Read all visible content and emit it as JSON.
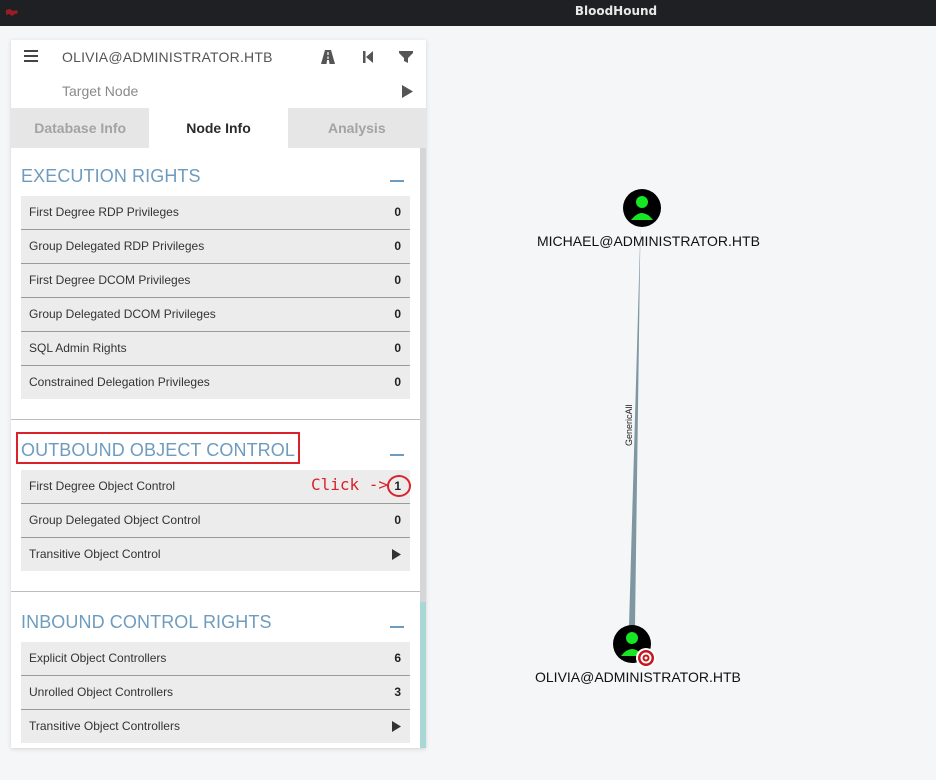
{
  "window": {
    "title": "BloodHound"
  },
  "search": {
    "source_node": "OLIVIA@ADMINISTRATOR.HTB",
    "target_placeholder": "Target Node"
  },
  "tabs": [
    {
      "label": "Database Info",
      "active": false
    },
    {
      "label": "Node Info",
      "active": true
    },
    {
      "label": "Analysis",
      "active": false
    }
  ],
  "sections": {
    "execution": {
      "title": "EXECUTION RIGHTS",
      "rows": [
        {
          "label": "First Degree RDP Privileges",
          "value": "0"
        },
        {
          "label": "Group Delegated RDP Privileges",
          "value": "0"
        },
        {
          "label": "First Degree DCOM Privileges",
          "value": "0"
        },
        {
          "label": "Group Delegated DCOM Privileges",
          "value": "0"
        },
        {
          "label": "SQL Admin Rights",
          "value": "0"
        },
        {
          "label": "Constrained Delegation Privileges",
          "value": "0"
        }
      ]
    },
    "outbound": {
      "title": "OUTBOUND OBJECT CONTROL",
      "rows": [
        {
          "label": "First Degree Object Control",
          "value": "1"
        },
        {
          "label": "Group Delegated Object Control",
          "value": "0"
        },
        {
          "label": "Transitive Object Control",
          "value": ""
        }
      ]
    },
    "inbound": {
      "title": "INBOUND CONTROL RIGHTS",
      "rows": [
        {
          "label": "Explicit Object Controllers",
          "value": "6"
        },
        {
          "label": "Unrolled Object Controllers",
          "value": "3"
        },
        {
          "label": "Transitive Object Controllers",
          "value": ""
        }
      ]
    }
  },
  "annotation": {
    "click_text": "Click ->"
  },
  "graph": {
    "nodes": [
      {
        "label": "MICHAEL@ADMINISTRATOR.HTB",
        "type": "user"
      },
      {
        "label": "OLIVIA@ADMINISTRATOR.HTB",
        "type": "user",
        "owned_target": true
      }
    ],
    "edge": {
      "label": "GenericAll"
    }
  },
  "colors": {
    "section_title": "#6d9cbf",
    "user_node_green": "#17e625",
    "node_black": "#000000",
    "annotation_red": "#d9222a"
  }
}
